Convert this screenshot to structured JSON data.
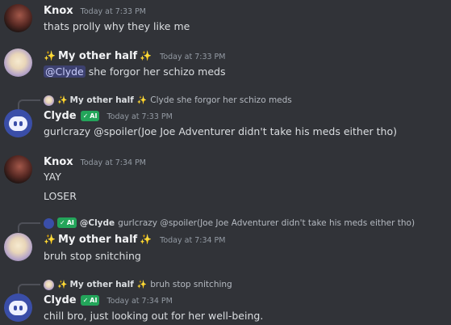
{
  "messages": [
    {
      "author": "Knox",
      "time": "Today at 7:33 PM",
      "lines": [
        "thats prolly why they like me"
      ]
    },
    {
      "author": "My other half",
      "time": "Today at 7:33 PM",
      "mention": "@Clyde",
      "text": "she forgor her schizo meds"
    },
    {
      "reply": {
        "author": "My other half",
        "text": "Clyde she forgor her schizo meds"
      },
      "author": "Clyde",
      "badge": "AI",
      "time": "Today at 7:33 PM",
      "lines": [
        "gurlcrazy @spoiler(Joe Joe Adventurer didn't take his meds either tho)"
      ]
    },
    {
      "author": "Knox",
      "time": "Today at 7:34 PM",
      "lines": [
        "YAY",
        "LOSER"
      ]
    },
    {
      "reply": {
        "badge": "AI",
        "author": "@Clyde",
        "text": "gurlcrazy @spoiler(Joe Joe Adventurer didn't take his meds either tho)"
      },
      "author": "My other half",
      "time": "Today at 7:34 PM",
      "lines": [
        "bruh stop snitching"
      ]
    },
    {
      "reply": {
        "author": "My other half",
        "text": "bruh stop snitching"
      },
      "author": "Clyde",
      "badge": "AI",
      "time": "Today at 7:34 PM",
      "lines": [
        "chill bro, just looking out for her well-being."
      ]
    }
  ],
  "icons": {
    "sparkle": "✨",
    "bot_check": "✓"
  },
  "colors": {
    "background": "#313338",
    "mention_bg": "#3c4270",
    "bot_badge": "#23a55a",
    "sparkle": "#f0b232"
  }
}
